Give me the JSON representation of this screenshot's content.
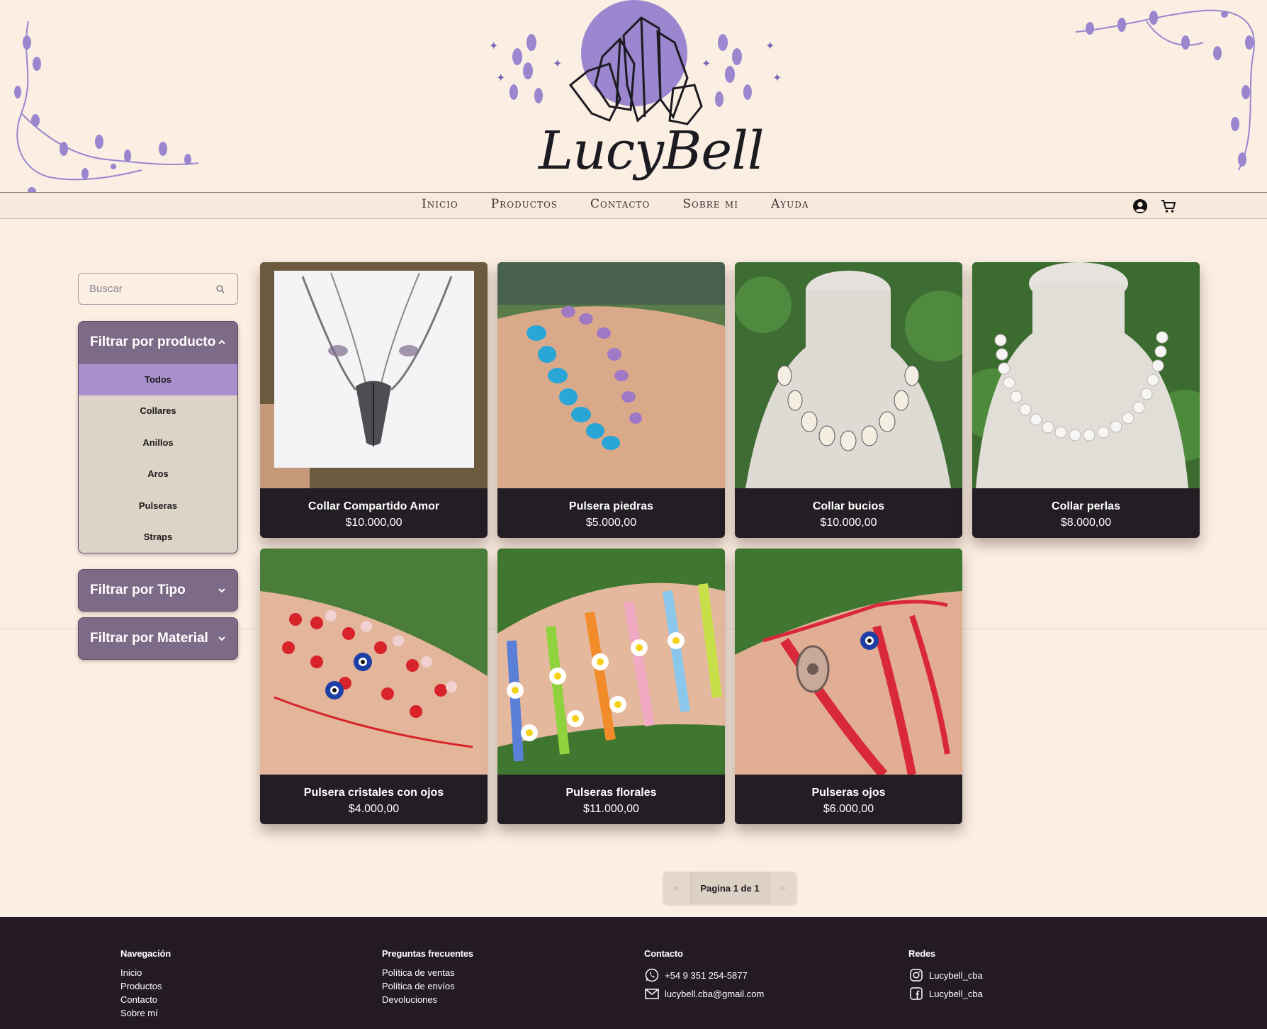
{
  "brand": {
    "name": "LucyBell"
  },
  "nav": {
    "links": [
      "Inicio",
      "Productos",
      "Contacto",
      "Sobre mi",
      "Ayuda"
    ]
  },
  "search": {
    "placeholder": "Buscar"
  },
  "filters": {
    "product": {
      "title": "Filtrar por producto",
      "items": [
        "Todos",
        "Collares",
        "Anillos",
        "Aros",
        "Pulseras",
        "Straps"
      ],
      "active": "Todos"
    },
    "type": {
      "title": "Filtrar por Tipo"
    },
    "material": {
      "title": "Filtrar por Material"
    }
  },
  "products": [
    {
      "name": "Collar Compartido Amor",
      "price": "$10.000,00"
    },
    {
      "name": "Pulsera piedras",
      "price": "$5.000,00"
    },
    {
      "name": "Collar bucios",
      "price": "$10.000,00"
    },
    {
      "name": "Collar perlas",
      "price": "$8.000,00"
    },
    {
      "name": "Pulsera cristales con ojos",
      "price": "$4.000,00"
    },
    {
      "name": "Pulseras florales",
      "price": "$11.000,00"
    },
    {
      "name": "Pulseras ojos",
      "price": "$6.000,00"
    }
  ],
  "pagination": {
    "label": "Pagina 1 de 1",
    "prev": "«",
    "next": "»"
  },
  "footer": {
    "navigation": {
      "title": "Navegación",
      "links": [
        "Inicio",
        "Productos",
        "Contacto",
        "Sobre mí"
      ]
    },
    "faq": {
      "title": "Preguntas frecuentes",
      "links": [
        "Política de ventas",
        "Política de envíos",
        "Devoluciones"
      ]
    },
    "contact": {
      "title": "Contacto",
      "phone": "+54 9 351 254-5877",
      "email": "lucybell.cba@gmail.com"
    },
    "social": {
      "title": "Redes",
      "instagram": "Lucybell_cba",
      "facebook": "Lucybell_cba"
    }
  },
  "colors": {
    "accent": "#a98fcd",
    "filter_bg": "#7d6a86",
    "footer_bg": "#231a24",
    "page_bg": "#fbeee2"
  }
}
